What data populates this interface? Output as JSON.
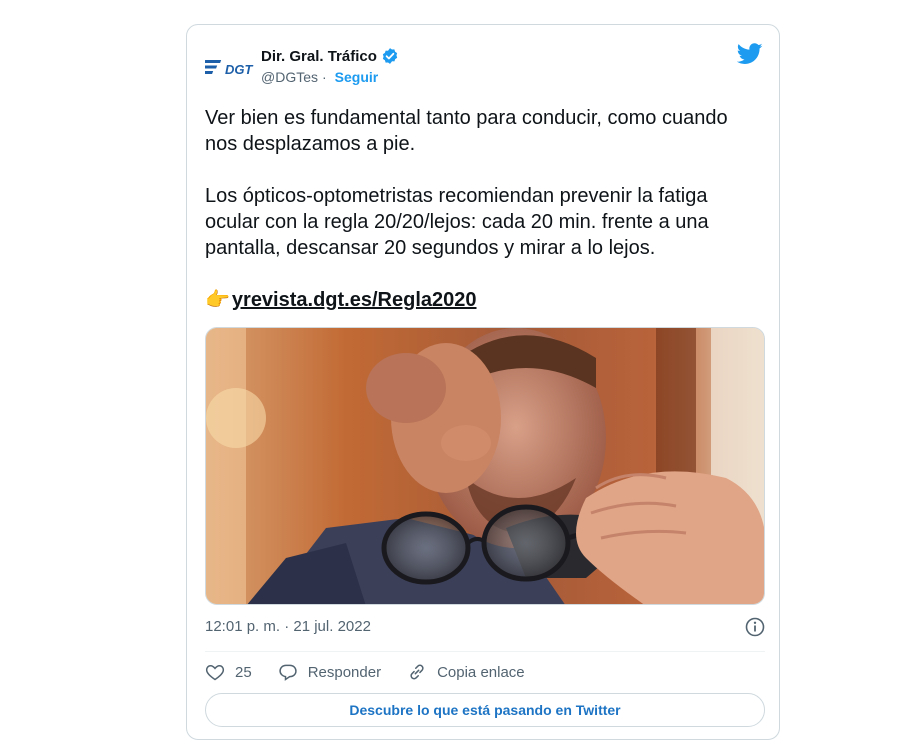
{
  "author": {
    "display_name": "Dir. Gral. Tráfico",
    "handle": "@DGTes",
    "separator": "·",
    "follow_label": "Seguir",
    "logo_text": "DGT"
  },
  "tweet": {
    "paragraph_1": "Ver bien es fundamental tanto para conducir, como cuando nos desplazamos a pie.",
    "paragraph_2": "Los ópticos-optometristas recomiendan prevenir la fatiga ocular con la regla 20/20/lejos: cada 20 min. frente a una pantalla, descansar 20 segundos y mirar a lo lejos.",
    "pointer_emoji": "👉",
    "link_text": "yrevista.dgt.es/Regla2020"
  },
  "meta": {
    "timestamp": "12:01 p. m. · 21 jul. 2022"
  },
  "actions": {
    "like_count": "25",
    "reply_label": "Responder",
    "copy_link_label": "Copia enlace"
  },
  "cta": {
    "label": "Descubre lo que está pasando en Twitter"
  },
  "colors": {
    "accent": "#1d9bf0",
    "text": "#0f1419",
    "muted": "#536471",
    "border": "#cfd9de"
  }
}
